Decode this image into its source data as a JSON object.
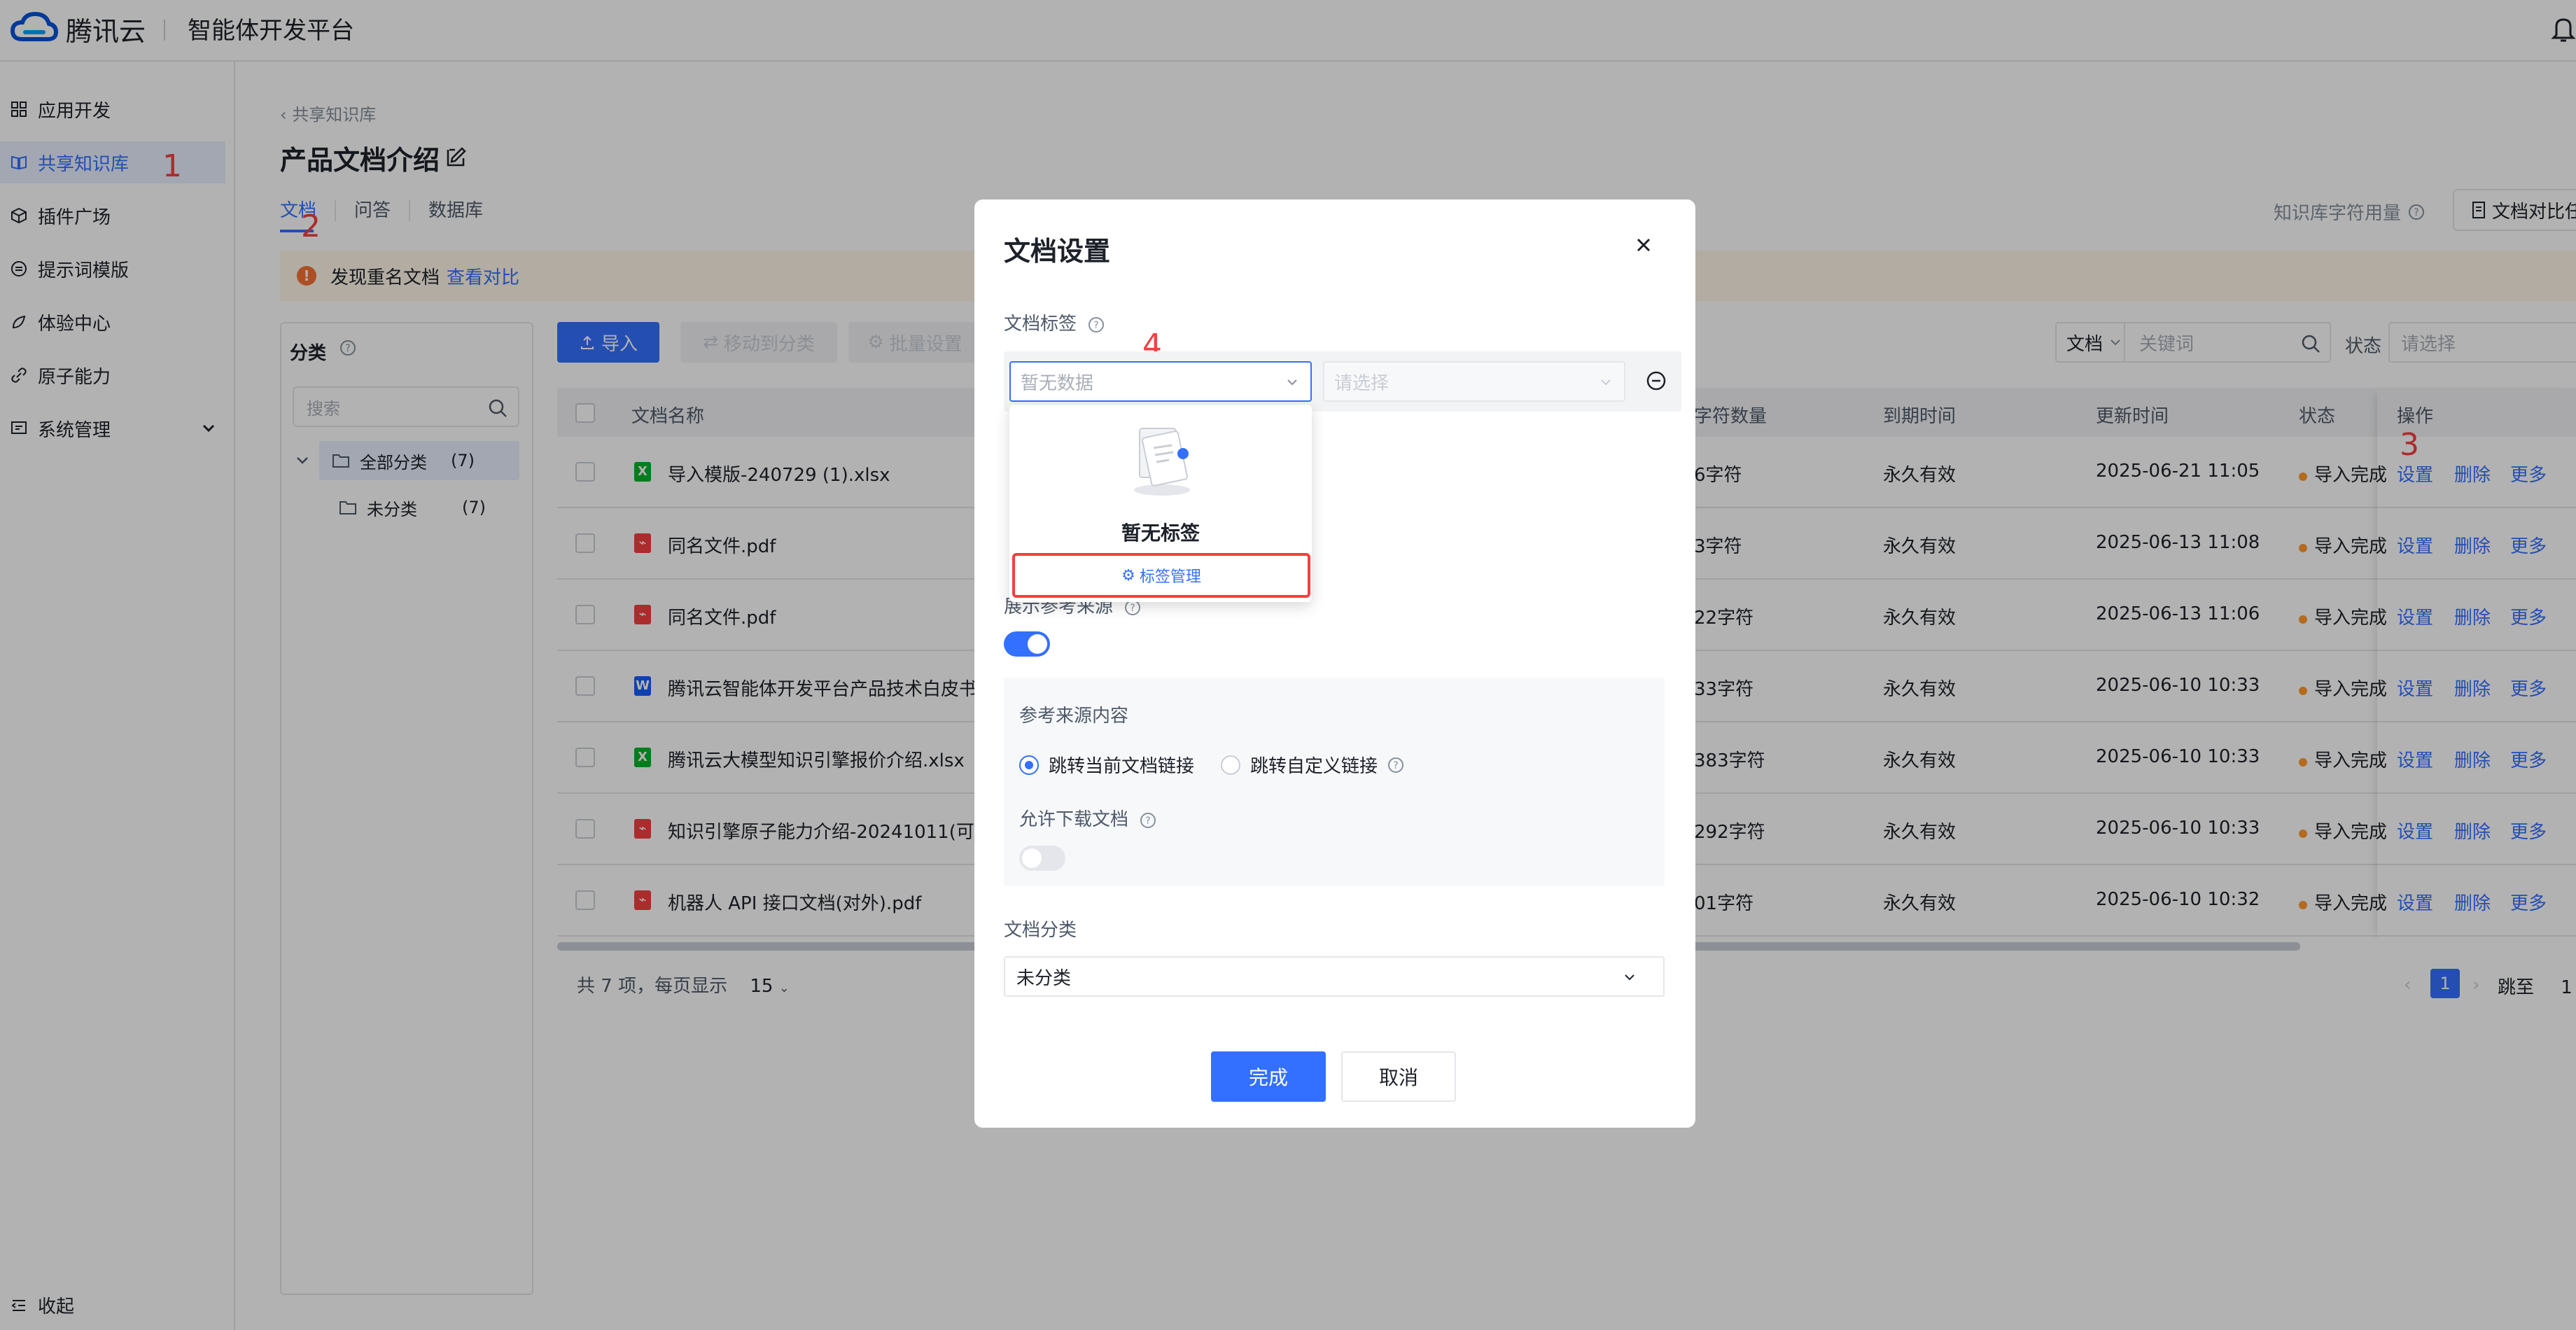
{
  "header": {
    "brand": "腾讯云",
    "platform": "智能体开发平台"
  },
  "sidebar": {
    "items": [
      {
        "label": "应用开发",
        "icon": "grid-icon"
      },
      {
        "label": "共享知识库",
        "icon": "book-icon"
      },
      {
        "label": "插件广场",
        "icon": "box-icon"
      },
      {
        "label": "提示词模版",
        "icon": "prompt-icon"
      },
      {
        "label": "体验中心",
        "icon": "rocket-icon"
      },
      {
        "label": "原子能力",
        "icon": "link-icon"
      },
      {
        "label": "系统管理",
        "icon": "settings-icon"
      }
    ],
    "collapse": "收起"
  },
  "main": {
    "breadcrumb": "共享知识库",
    "title": "产品文档介绍",
    "tabs": [
      "文档",
      "问答",
      "数据库"
    ],
    "usage_label": "知识库字符用量",
    "compare_button": "文档对比任",
    "alert": {
      "text": "发现重名文档",
      "link": "查看对比"
    }
  },
  "category": {
    "title": "分类",
    "search_placeholder": "搜索",
    "all": {
      "label": "全部分类",
      "count": "(7)"
    },
    "sub": {
      "label": "未分类",
      "count": "(7)"
    }
  },
  "toolbar": {
    "import": "导入",
    "move": "移动到分类",
    "batch": "批量设置",
    "filter_type": "文档",
    "keyword_placeholder": "关键词",
    "status_label": "状态",
    "status_placeholder": "请选择"
  },
  "table": {
    "headers": {
      "name": "文档名称",
      "chars": "字符数量",
      "expire": "到期时间",
      "updated": "更新时间",
      "status": "状态",
      "ops": "操作"
    },
    "rows": [
      {
        "type": "X",
        "name": "导入模版-240729 (1).xlsx",
        "chars": "6字符",
        "expire": "永久有效",
        "updated": "2025-06-21 11:05",
        "status": "导入完成"
      },
      {
        "type": "PDF",
        "name": "同名文件.pdf",
        "chars": "3字符",
        "expire": "永久有效",
        "updated": "2025-06-13 11:08",
        "status": "导入完成"
      },
      {
        "type": "PDF",
        "name": "同名文件.pdf",
        "chars": "22字符",
        "expire": "永久有效",
        "updated": "2025-06-13 11:06",
        "status": "导入完成"
      },
      {
        "type": "W",
        "name": "腾讯云智能体开发平台产品技术白皮书(",
        "chars": "33字符",
        "expire": "永久有效",
        "updated": "2025-06-10 10:33",
        "status": "导入完成"
      },
      {
        "type": "X",
        "name": "腾讯云大模型知识引擎报价介绍.xlsx",
        "chars": "383字符",
        "expire": "永久有效",
        "updated": "2025-06-10 10:33",
        "status": "导入完成"
      },
      {
        "type": "PDF",
        "name": "知识引擎原子能力介绍-20241011(可对",
        "chars": "292字符",
        "expire": "永久有效",
        "updated": "2025-06-10 10:33",
        "status": "导入完成"
      },
      {
        "type": "PDF",
        "name": "机器人 API 接口文档(对外).pdf",
        "chars": "01字符",
        "expire": "永久有效",
        "updated": "2025-06-10 10:32",
        "status": "导入完成"
      }
    ],
    "ops": {
      "settings": "设置",
      "delete": "删除",
      "more": "更多"
    },
    "footer_total": "共 7 项，每页显示",
    "page_size": "15",
    "current_page": "1",
    "jump_label": "跳至",
    "jump_value": "1"
  },
  "annotations": [
    "1",
    "2",
    "3",
    "4"
  ],
  "modal": {
    "title": "文档设置",
    "tag_label": "文档标签",
    "tag_placeholder": "暂无数据",
    "value_placeholder": "请选择",
    "empty_text": "暂无标签",
    "tag_manage": "标签管理",
    "show_ref_label": "展示参考来源",
    "ref_content_label": "参考来源内容",
    "ref_option_current": "跳转当前文档链接",
    "ref_option_custom": "跳转自定义链接",
    "allow_download_label": "允许下载文档",
    "category_label": "文档分类",
    "category_value": "未分类",
    "confirm": "完成",
    "cancel": "取消"
  },
  "colors": {
    "accent": "#3470ff",
    "annotation": "#f53f3f",
    "warning": "#f77234"
  }
}
